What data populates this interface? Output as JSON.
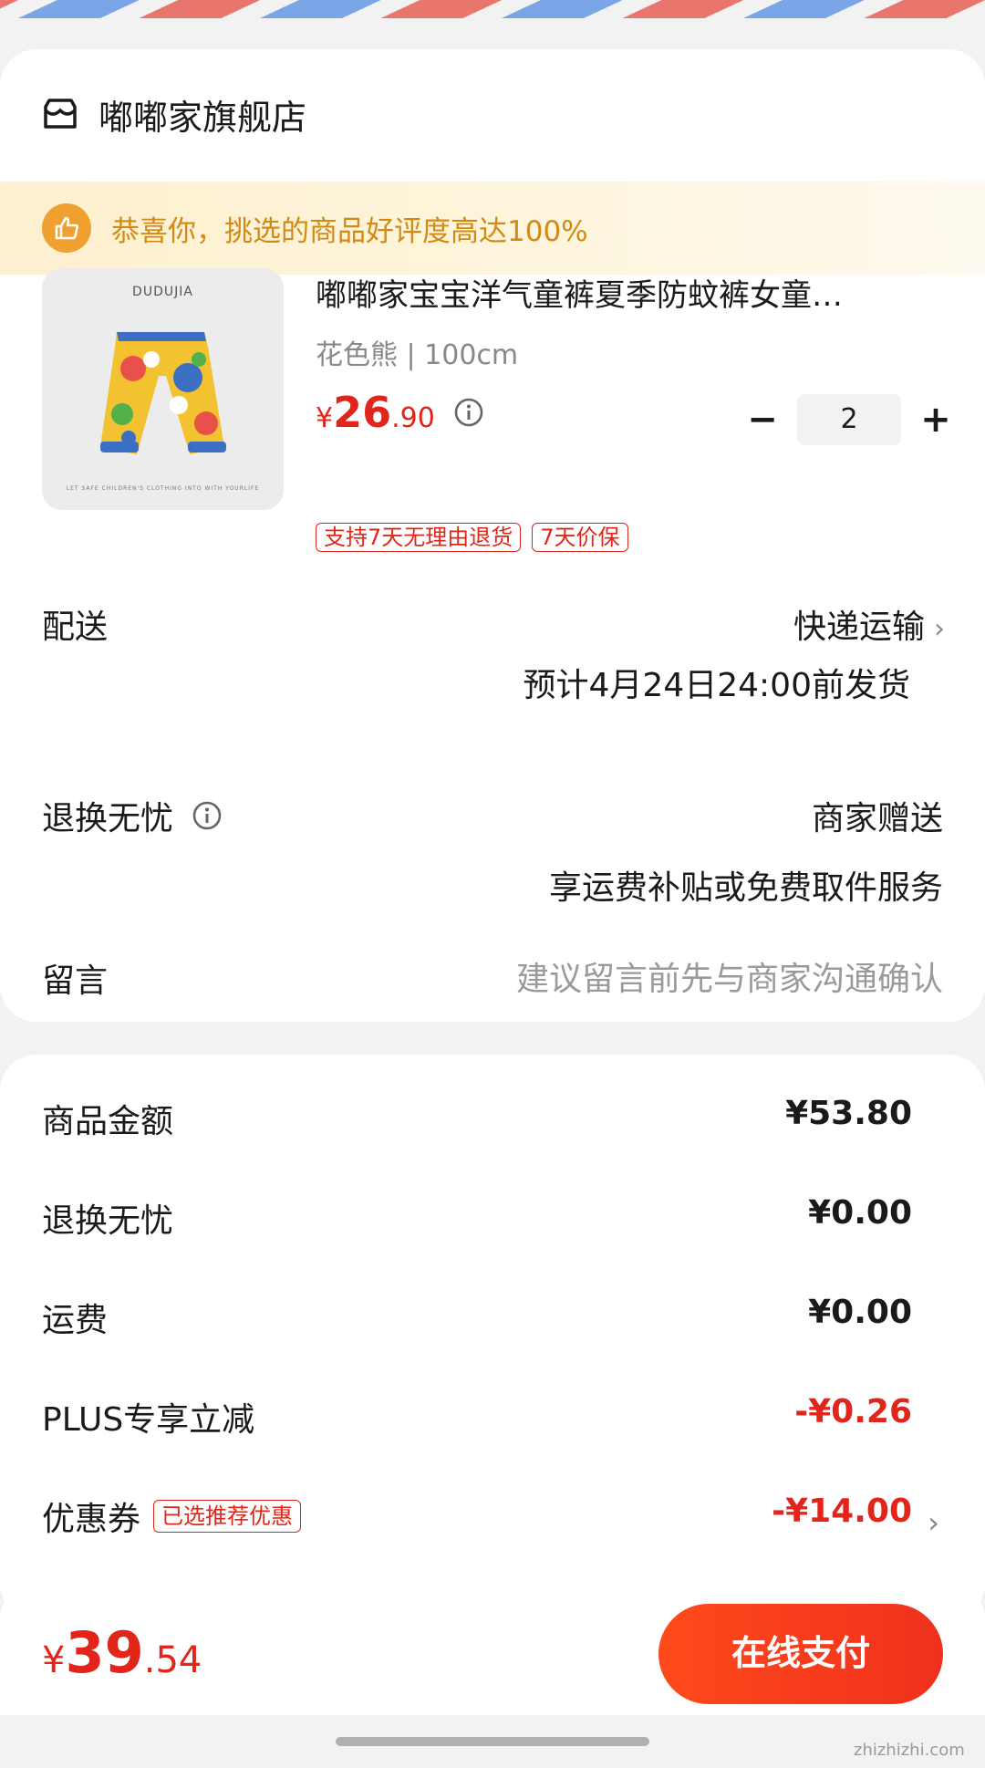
{
  "store": {
    "name": "嘟嘟家旗舰店"
  },
  "banner": {
    "text": "恭喜你，挑选的商品好评度高达100%"
  },
  "product": {
    "image_brand": "DUDUJIA",
    "image_tagline": "LET SAFE CHILDREN'S CLOTHING INTO WITH YOURLIFE",
    "title": "嘟嘟家宝宝洋气童裤夏季防蚊裤女童…",
    "spec": "花色熊 | 100cm",
    "price": {
      "symbol": "¥",
      "integer": "26",
      "decimal": ".90"
    },
    "quantity": "2",
    "minus": "−",
    "plus": "+",
    "tags": [
      "支持7天无理由退货",
      "7天价保"
    ]
  },
  "delivery": {
    "label": "配送",
    "method": "快递运输",
    "eta": "预计4月24日24:00前发货"
  },
  "returns": {
    "label": "退换无忧",
    "value": "商家赠送",
    "sub": "享运费补贴或免费取件服务"
  },
  "message": {
    "label": "留言",
    "placeholder": "建议留言前先与商家沟通确认"
  },
  "summary": {
    "goods_amount": {
      "label": "商品金额",
      "value": "¥53.80"
    },
    "returns_fee": {
      "label": "退换无忧",
      "value": "¥0.00"
    },
    "shipping": {
      "label": "运费",
      "value": "¥0.00"
    },
    "plus_discount": {
      "label": "PLUS专享立减",
      "value": "-¥0.26"
    },
    "coupon": {
      "label": "优惠券",
      "tag": "已选推荐优惠",
      "value": "-¥14.00"
    }
  },
  "footer": {
    "total": {
      "symbol": "¥",
      "integer": "39",
      "decimal": ".54"
    },
    "pay_label": "在线支付"
  },
  "watermark": "zhizhizhi.com",
  "colors": {
    "accent_red": "#e1251b",
    "banner_orange": "#f0a030",
    "pay_button": "#ff4a1c"
  },
  "icons": {
    "store": "store-icon",
    "thumb": "thumbs-up-icon",
    "info": "info-icon",
    "chevron": "chevron-right-icon"
  }
}
